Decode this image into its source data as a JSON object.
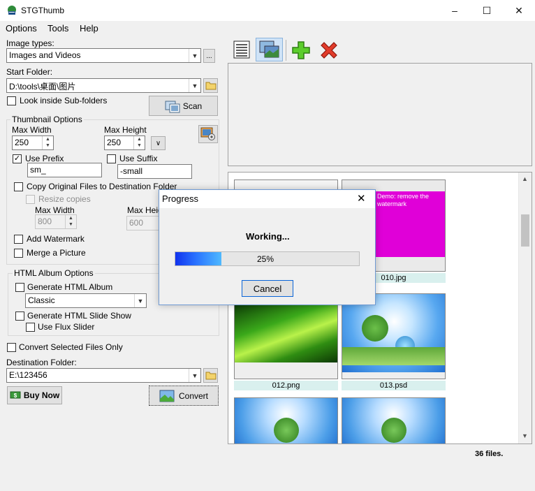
{
  "window": {
    "title": "STGThumb",
    "controls": [
      "minimize",
      "maximize",
      "close"
    ]
  },
  "menu": [
    "Options",
    "Tools",
    "Help"
  ],
  "left": {
    "image_types_label": "Image types:",
    "image_types_value": "Images and Videos",
    "ellipsis_label": "...",
    "start_folder_label": "Start Folder:",
    "start_folder_value": "D:\\tools\\桌面\\图片",
    "look_inside_label": "Look inside Sub-folders",
    "scan_label": "Scan",
    "thumb_options_title": "Thumbnail Options",
    "max_width_label": "Max Width",
    "max_height_label": "Max Height",
    "max_width_value": "250",
    "max_height_value": "250",
    "use_prefix_label": "Use Prefix",
    "prefix_value": "sm_",
    "use_suffix_label": "Use Suffix",
    "suffix_value": "-small",
    "copy_original_label": "Copy Original Files to Destination Folder",
    "resize_copies_label": "Resize copies",
    "copy_max_width_label": "Max Width",
    "copy_max_height_label": "Max Heig",
    "copy_max_width_value": "800",
    "copy_max_height_value": "600",
    "add_watermark_label": "Add Watermark",
    "merge_picture_label": "Merge a Picture",
    "html_album_title": "HTML Album Options",
    "generate_album_label": "Generate HTML Album",
    "album_style_value": "Classic",
    "generate_slideshow_label": "Generate HTML Slide Show",
    "use_flux_label": "Use Flux Slider",
    "convert_selected_label": "Convert Selected Files Only",
    "dest_folder_label": "Destination Folder:",
    "dest_folder_value": "E:\\123456",
    "buy_now_label": "Buy Now",
    "convert_label": "Convert"
  },
  "gallery": {
    "captions": [
      "010.jpg",
      "012.png",
      "013.psd"
    ],
    "watermark_text": "Demo: remove the watermark",
    "files_count": "36 files."
  },
  "dialog": {
    "title": "Progress",
    "status": "Working...",
    "progress_text": "25%",
    "progress_value": 0.25,
    "cancel_label": "Cancel"
  },
  "colors": {
    "accent_blue": "#0a64d8",
    "caption_bg": "#d9f0ee",
    "magenta": "#e000d8"
  }
}
